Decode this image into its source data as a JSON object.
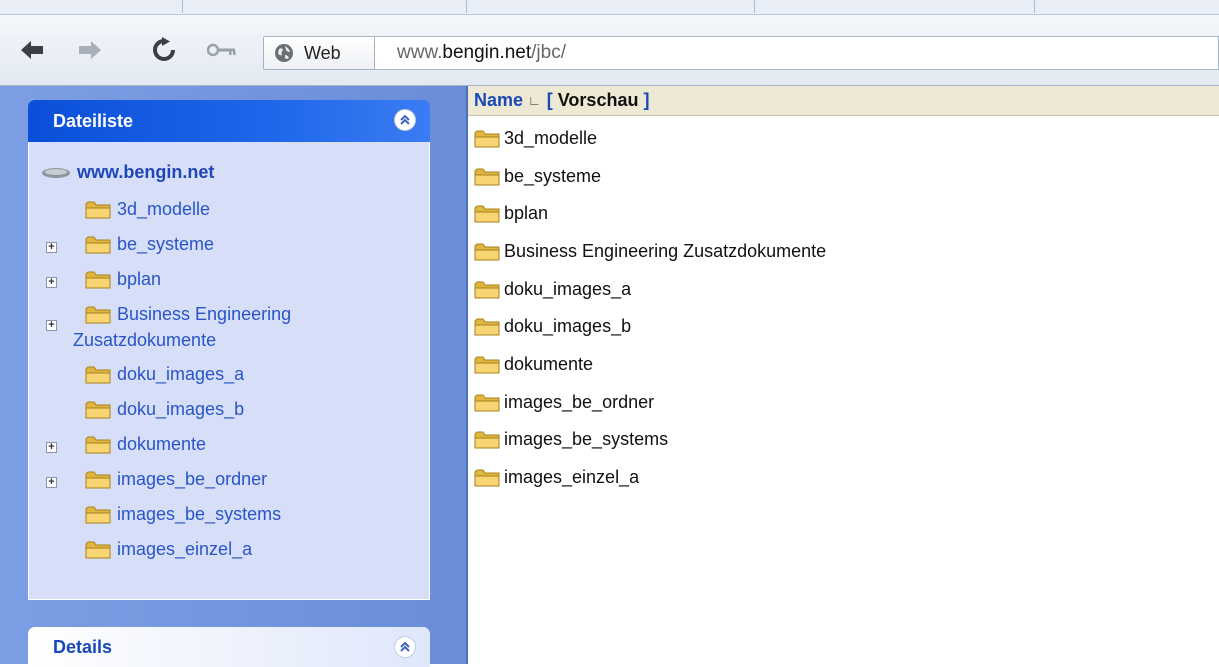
{
  "toolbar": {
    "identity_label": "Web",
    "url_prefix": "www.",
    "url_host": "bengin.net",
    "url_path": "/jbc/"
  },
  "sidebar": {
    "filelist_title": "Dateiliste",
    "root": "www.bengin.net",
    "items": [
      {
        "label": "3d_modelle"
      },
      {
        "label": "be_systeme"
      },
      {
        "label": "bplan"
      },
      {
        "label": "Business Engineering",
        "label2": "Zusatzdokumente"
      },
      {
        "label": "doku_images_a"
      },
      {
        "label": "doku_images_b"
      },
      {
        "label": "dokumente"
      },
      {
        "label": "images_be_ordner"
      },
      {
        "label": "images_be_systems"
      },
      {
        "label": "images_einzel_a"
      }
    ],
    "details_title": "Details"
  },
  "main": {
    "col_name": "Name",
    "sort_indicator": "∟",
    "vorschau_open": "[ ",
    "vorschau": "Vorschau",
    "vorschau_close": " ]",
    "rows": [
      "3d_modelle",
      "be_systeme",
      "bplan",
      "Business Engineering Zusatzdokumente",
      "doku_images_a",
      "doku_images_b",
      "dokumente",
      "images_be_ordner",
      "images_be_systems",
      "images_einzel_a"
    ]
  }
}
